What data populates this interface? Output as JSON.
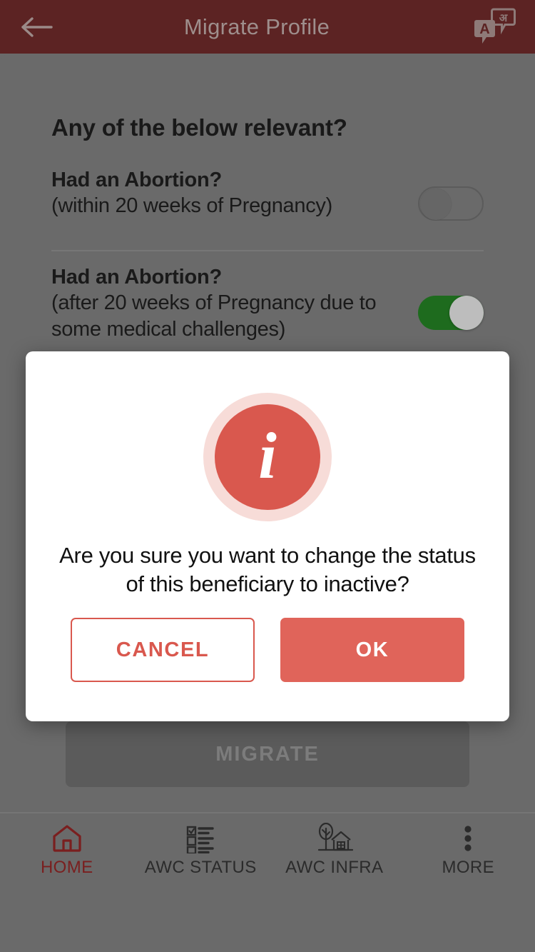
{
  "header": {
    "title": "Migrate Profile",
    "back_icon": "back-arrow-icon",
    "translate_icon": "translate-icon",
    "translate_latin_char": "A",
    "translate_devanagari_char": "अ",
    "background_color": "#5c2323"
  },
  "main": {
    "section_title": "Any of the below relevant?",
    "questions": [
      {
        "label": "Had an Abortion?",
        "sub_label": "(within 20 weeks of Pregnancy)",
        "toggle_state": "off"
      },
      {
        "label": "Had an Abortion?",
        "sub_label": "(after 20 weeks of Pregnancy due to some medical challenges)",
        "toggle_state": "on"
      }
    ],
    "submit_label": "MIGRATE"
  },
  "dialog": {
    "icon": "info-icon",
    "icon_glyph": "i",
    "icon_color": "#d9584e",
    "icon_ring_color": "#f7dcd8",
    "message": "Are you sure you want to change the status of this beneficiary to inactive?",
    "cancel_label": "CANCEL",
    "ok_label": "OK",
    "ok_color": "#e0645a"
  },
  "bottom_nav": {
    "items": [
      {
        "label": "HOME",
        "icon": "home-icon",
        "active": true
      },
      {
        "label": "AWC STATUS",
        "icon": "checklist-icon",
        "active": false
      },
      {
        "label": "AWC INFRA",
        "icon": "tree-house-icon",
        "active": false
      },
      {
        "label": "MORE",
        "icon": "more-vertical-icon",
        "active": false
      }
    ],
    "active_color": "#7a1f1f"
  }
}
